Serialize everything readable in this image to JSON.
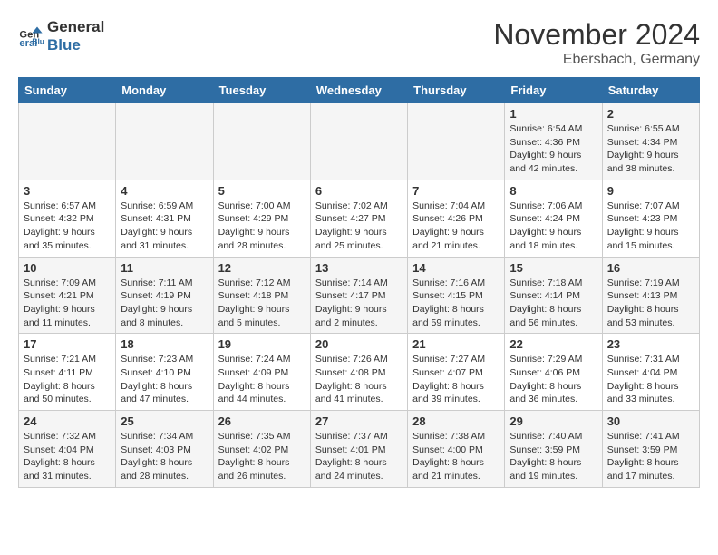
{
  "logo": {
    "line1": "General",
    "line2": "Blue"
  },
  "title": "November 2024",
  "location": "Ebersbach, Germany",
  "days_of_week": [
    "Sunday",
    "Monday",
    "Tuesday",
    "Wednesday",
    "Thursday",
    "Friday",
    "Saturday"
  ],
  "weeks": [
    [
      {
        "day": "",
        "info": ""
      },
      {
        "day": "",
        "info": ""
      },
      {
        "day": "",
        "info": ""
      },
      {
        "day": "",
        "info": ""
      },
      {
        "day": "",
        "info": ""
      },
      {
        "day": "1",
        "info": "Sunrise: 6:54 AM\nSunset: 4:36 PM\nDaylight: 9 hours\nand 42 minutes."
      },
      {
        "day": "2",
        "info": "Sunrise: 6:55 AM\nSunset: 4:34 PM\nDaylight: 9 hours\nand 38 minutes."
      }
    ],
    [
      {
        "day": "3",
        "info": "Sunrise: 6:57 AM\nSunset: 4:32 PM\nDaylight: 9 hours\nand 35 minutes."
      },
      {
        "day": "4",
        "info": "Sunrise: 6:59 AM\nSunset: 4:31 PM\nDaylight: 9 hours\nand 31 minutes."
      },
      {
        "day": "5",
        "info": "Sunrise: 7:00 AM\nSunset: 4:29 PM\nDaylight: 9 hours\nand 28 minutes."
      },
      {
        "day": "6",
        "info": "Sunrise: 7:02 AM\nSunset: 4:27 PM\nDaylight: 9 hours\nand 25 minutes."
      },
      {
        "day": "7",
        "info": "Sunrise: 7:04 AM\nSunset: 4:26 PM\nDaylight: 9 hours\nand 21 minutes."
      },
      {
        "day": "8",
        "info": "Sunrise: 7:06 AM\nSunset: 4:24 PM\nDaylight: 9 hours\nand 18 minutes."
      },
      {
        "day": "9",
        "info": "Sunrise: 7:07 AM\nSunset: 4:23 PM\nDaylight: 9 hours\nand 15 minutes."
      }
    ],
    [
      {
        "day": "10",
        "info": "Sunrise: 7:09 AM\nSunset: 4:21 PM\nDaylight: 9 hours\nand 11 minutes."
      },
      {
        "day": "11",
        "info": "Sunrise: 7:11 AM\nSunset: 4:19 PM\nDaylight: 9 hours\nand 8 minutes."
      },
      {
        "day": "12",
        "info": "Sunrise: 7:12 AM\nSunset: 4:18 PM\nDaylight: 9 hours\nand 5 minutes."
      },
      {
        "day": "13",
        "info": "Sunrise: 7:14 AM\nSunset: 4:17 PM\nDaylight: 9 hours\nand 2 minutes."
      },
      {
        "day": "14",
        "info": "Sunrise: 7:16 AM\nSunset: 4:15 PM\nDaylight: 8 hours\nand 59 minutes."
      },
      {
        "day": "15",
        "info": "Sunrise: 7:18 AM\nSunset: 4:14 PM\nDaylight: 8 hours\nand 56 minutes."
      },
      {
        "day": "16",
        "info": "Sunrise: 7:19 AM\nSunset: 4:13 PM\nDaylight: 8 hours\nand 53 minutes."
      }
    ],
    [
      {
        "day": "17",
        "info": "Sunrise: 7:21 AM\nSunset: 4:11 PM\nDaylight: 8 hours\nand 50 minutes."
      },
      {
        "day": "18",
        "info": "Sunrise: 7:23 AM\nSunset: 4:10 PM\nDaylight: 8 hours\nand 47 minutes."
      },
      {
        "day": "19",
        "info": "Sunrise: 7:24 AM\nSunset: 4:09 PM\nDaylight: 8 hours\nand 44 minutes."
      },
      {
        "day": "20",
        "info": "Sunrise: 7:26 AM\nSunset: 4:08 PM\nDaylight: 8 hours\nand 41 minutes."
      },
      {
        "day": "21",
        "info": "Sunrise: 7:27 AM\nSunset: 4:07 PM\nDaylight: 8 hours\nand 39 minutes."
      },
      {
        "day": "22",
        "info": "Sunrise: 7:29 AM\nSunset: 4:06 PM\nDaylight: 8 hours\nand 36 minutes."
      },
      {
        "day": "23",
        "info": "Sunrise: 7:31 AM\nSunset: 4:04 PM\nDaylight: 8 hours\nand 33 minutes."
      }
    ],
    [
      {
        "day": "24",
        "info": "Sunrise: 7:32 AM\nSunset: 4:04 PM\nDaylight: 8 hours\nand 31 minutes."
      },
      {
        "day": "25",
        "info": "Sunrise: 7:34 AM\nSunset: 4:03 PM\nDaylight: 8 hours\nand 28 minutes."
      },
      {
        "day": "26",
        "info": "Sunrise: 7:35 AM\nSunset: 4:02 PM\nDaylight: 8 hours\nand 26 minutes."
      },
      {
        "day": "27",
        "info": "Sunrise: 7:37 AM\nSunset: 4:01 PM\nDaylight: 8 hours\nand 24 minutes."
      },
      {
        "day": "28",
        "info": "Sunrise: 7:38 AM\nSunset: 4:00 PM\nDaylight: 8 hours\nand 21 minutes."
      },
      {
        "day": "29",
        "info": "Sunrise: 7:40 AM\nSunset: 3:59 PM\nDaylight: 8 hours\nand 19 minutes."
      },
      {
        "day": "30",
        "info": "Sunrise: 7:41 AM\nSunset: 3:59 PM\nDaylight: 8 hours\nand 17 minutes."
      }
    ]
  ]
}
